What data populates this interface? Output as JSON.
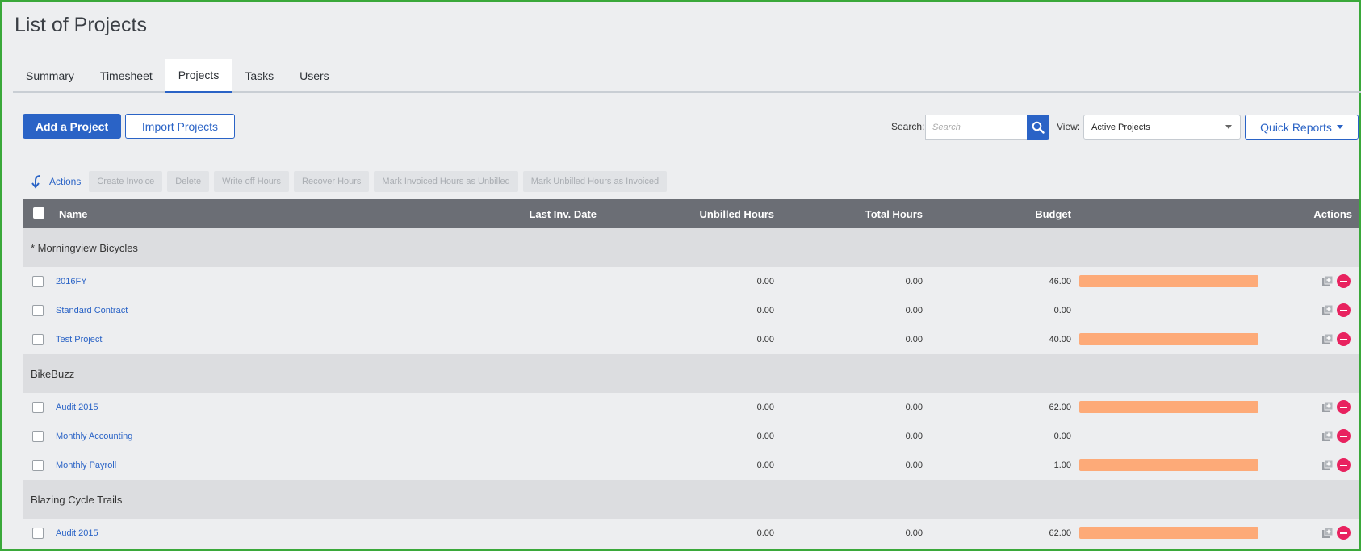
{
  "page": {
    "title": "List of Projects"
  },
  "tabs": [
    {
      "label": "Summary",
      "active": false
    },
    {
      "label": "Timesheet",
      "active": false
    },
    {
      "label": "Projects",
      "active": true
    },
    {
      "label": "Tasks",
      "active": false
    },
    {
      "label": "Users",
      "active": false
    }
  ],
  "toolbar": {
    "add_label": "Add a Project",
    "import_label": "Import Projects",
    "search_label": "Search:",
    "search_placeholder": "Search",
    "view_label": "View:",
    "view_value": "Active Projects",
    "quick_reports_label": "Quick Reports"
  },
  "actions_bar": {
    "toggle_label": "Actions",
    "items": [
      "Create Invoice",
      "Delete",
      "Write off Hours",
      "Recover Hours",
      "Mark Invoiced Hours as Unbilled",
      "Mark Unbilled Hours as Invoiced"
    ]
  },
  "table": {
    "headers": {
      "name": "Name",
      "last_inv_date": "Last Inv. Date",
      "unbilled_hours": "Unbilled Hours",
      "total_hours": "Total Hours",
      "budget": "Budget",
      "actions": "Actions"
    },
    "groups": [
      {
        "name": "* Morningview Bicycles",
        "rows": [
          {
            "name": "2016FY",
            "last_inv_date": "",
            "unbilled": "0.00",
            "total": "0.00",
            "budget": "46.00",
            "has_bar": true
          },
          {
            "name": "Standard Contract",
            "last_inv_date": "",
            "unbilled": "0.00",
            "total": "0.00",
            "budget": "0.00",
            "has_bar": false
          },
          {
            "name": "Test Project",
            "last_inv_date": "",
            "unbilled": "0.00",
            "total": "0.00",
            "budget": "40.00",
            "has_bar": true
          }
        ]
      },
      {
        "name": "BikeBuzz",
        "rows": [
          {
            "name": "Audit 2015",
            "last_inv_date": "",
            "unbilled": "0.00",
            "total": "0.00",
            "budget": "62.00",
            "has_bar": true
          },
          {
            "name": "Monthly Accounting",
            "last_inv_date": "",
            "unbilled": "0.00",
            "total": "0.00",
            "budget": "0.00",
            "has_bar": false
          },
          {
            "name": "Monthly Payroll",
            "last_inv_date": "",
            "unbilled": "0.00",
            "total": "0.00",
            "budget": "1.00",
            "has_bar": true
          }
        ]
      },
      {
        "name": "Blazing Cycle Trails",
        "rows": [
          {
            "name": "Audit 2015",
            "last_inv_date": "",
            "unbilled": "0.00",
            "total": "0.00",
            "budget": "62.00",
            "has_bar": true
          }
        ]
      }
    ]
  },
  "colors": {
    "primary": "#2a63c6",
    "budget_bar": "#fdaa78",
    "remove": "#e8225f",
    "header_bg": "#6b6e75",
    "frame": "#3aa83a"
  },
  "icons": {
    "search": "search-icon",
    "actions_toggle": "arrow-down-left-icon",
    "copy": "copy-add-icon",
    "remove": "remove-circle-icon"
  }
}
